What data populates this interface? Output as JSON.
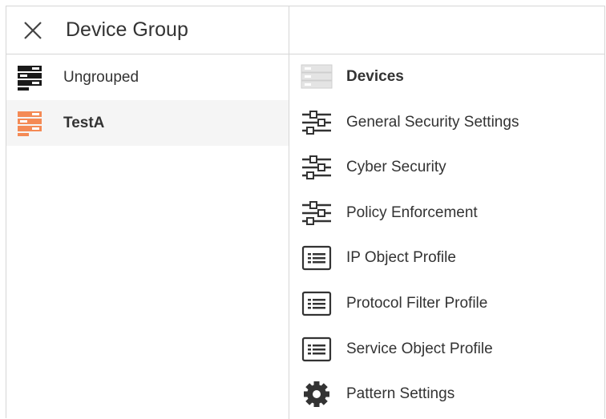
{
  "header": {
    "title": "Device Group"
  },
  "groups": [
    {
      "label": "Ungrouped",
      "icon": "server-rack-icon",
      "color": "#1a1a1a"
    },
    {
      "label": "TestA",
      "icon": "server-rack-icon",
      "color": "#f48a55",
      "selected": true
    }
  ],
  "menu": [
    {
      "label": "Devices",
      "icon": "devices-icon",
      "active": true
    },
    {
      "label": "General Security Settings",
      "icon": "sliders-icon"
    },
    {
      "label": "Cyber Security",
      "icon": "sliders-icon"
    },
    {
      "label": "Policy Enforcement",
      "icon": "sliders-icon"
    },
    {
      "label": "IP Object Profile",
      "icon": "list-card-icon"
    },
    {
      "label": "Protocol Filter Profile",
      "icon": "list-card-icon"
    },
    {
      "label": "Service Object Profile",
      "icon": "list-card-icon"
    },
    {
      "label": "Pattern Settings",
      "icon": "gear-icon"
    }
  ],
  "colors": {
    "selected_bg": "#f5f5f5",
    "border": "#d6d6d6",
    "icon_dark": "#333333",
    "accent_orange": "#f48a55"
  }
}
